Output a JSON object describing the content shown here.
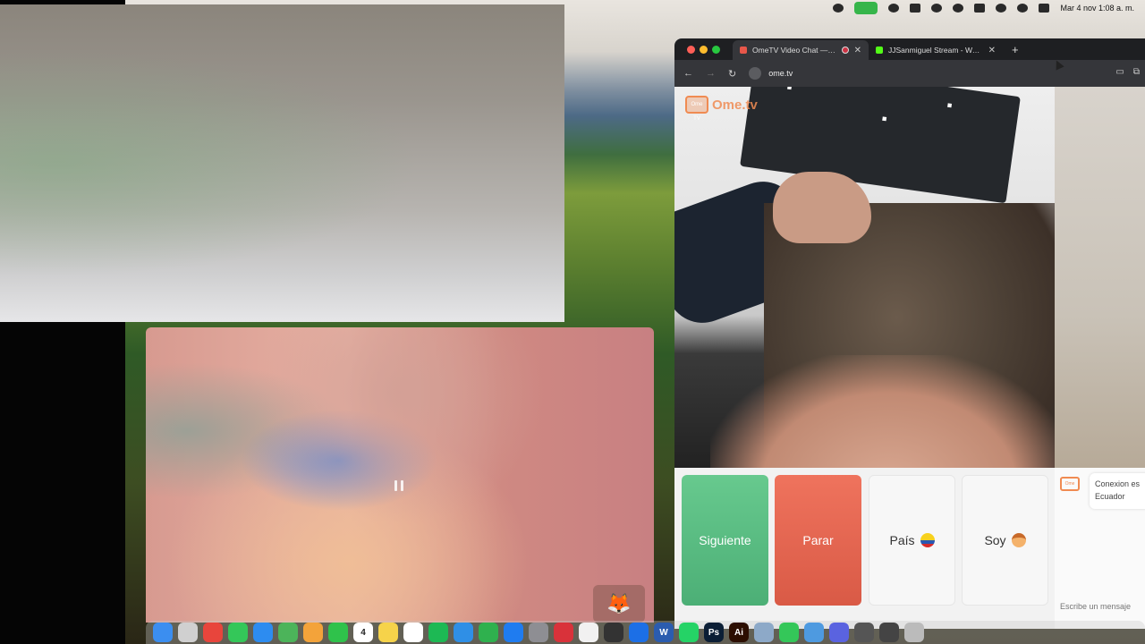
{
  "menubar": {
    "clock": "Mar 4 nov  1:08 a. m."
  },
  "browser": {
    "tabs": [
      {
        "label": "OmeTV Video Chat — Om",
        "favicon_color": "#e8574a",
        "active": true
      },
      {
        "label": "JJSanmiguel Stream - Watch",
        "favicon_color": "#53fc18",
        "active": false
      }
    ],
    "new_tab": "+",
    "url": "ome.tv"
  },
  "ome": {
    "logo_text": "Ome.tv",
    "logo_box": "Ome TV"
  },
  "controls": {
    "next_label": "Siguiente",
    "stop_label": "Parar",
    "country_label": "País",
    "gender_label": "Soy"
  },
  "chat": {
    "line1": "Conexion es",
    "line2": "Ecuador",
    "input_placeholder": "Escribe un mensaje"
  },
  "dock": {
    "apps": [
      {
        "name": "finder-icon",
        "color": "#3b8ef0",
        "glyph": ""
      },
      {
        "name": "launchpad-icon",
        "color": "#d0d0d0",
        "glyph": ""
      },
      {
        "name": "chrome-icon",
        "color": "#e8453c",
        "glyph": ""
      },
      {
        "name": "messages-icon",
        "color": "#34c759",
        "glyph": ""
      },
      {
        "name": "mail-icon",
        "color": "#2d8cf0",
        "glyph": ""
      },
      {
        "name": "maps-icon",
        "color": "#4cb45a",
        "glyph": ""
      },
      {
        "name": "photos-icon",
        "color": "#f3a33a",
        "glyph": ""
      },
      {
        "name": "facetime-icon",
        "color": "#2fc24b",
        "glyph": ""
      },
      {
        "name": "calendar-icon",
        "color": "#ffffff",
        "glyph": "4"
      },
      {
        "name": "notes-icon",
        "color": "#f6d34a",
        "glyph": ""
      },
      {
        "name": "freeform-icon",
        "color": "#ffffff",
        "glyph": ""
      },
      {
        "name": "spotify-icon",
        "color": "#1db954",
        "glyph": ""
      },
      {
        "name": "keynote-icon",
        "color": "#2f8fe6",
        "glyph": ""
      },
      {
        "name": "numbers-icon",
        "color": "#2fb14e",
        "glyph": ""
      },
      {
        "name": "appstore-icon",
        "color": "#1f7cf0",
        "glyph": ""
      },
      {
        "name": "settings-icon",
        "color": "#8e8e93",
        "glyph": ""
      },
      {
        "name": "pdf-app-icon",
        "color": "#d9323a",
        "glyph": ""
      },
      {
        "name": "pages-icon",
        "color": "#f1f1f1",
        "glyph": ""
      },
      {
        "name": "davinci-icon",
        "color": "#333333",
        "glyph": ""
      },
      {
        "name": "xcode-icon",
        "color": "#1c6fe6",
        "glyph": ""
      },
      {
        "name": "word-icon",
        "color": "#2b5caf",
        "glyph": "W"
      },
      {
        "name": "whatsapp-icon",
        "color": "#25d366",
        "glyph": ""
      },
      {
        "name": "photoshop-icon",
        "color": "#0b1e35",
        "glyph": "Ps"
      },
      {
        "name": "illustrator-icon",
        "color": "#2c0e00",
        "glyph": "Ai"
      },
      {
        "name": "finder-window-icon",
        "color": "#8da9c8",
        "glyph": ""
      },
      {
        "name": "green-app-icon",
        "color": "#34c759",
        "glyph": ""
      },
      {
        "name": "weather-icon",
        "color": "#4e9ae0",
        "glyph": ""
      },
      {
        "name": "screen-icon",
        "color": "#5a63e0",
        "glyph": ""
      },
      {
        "name": "preview-icon",
        "color": "#555555",
        "glyph": ""
      },
      {
        "name": "files-icon",
        "color": "#444444",
        "glyph": ""
      },
      {
        "name": "trash-icon",
        "color": "#bbbbbb",
        "glyph": ""
      }
    ]
  }
}
